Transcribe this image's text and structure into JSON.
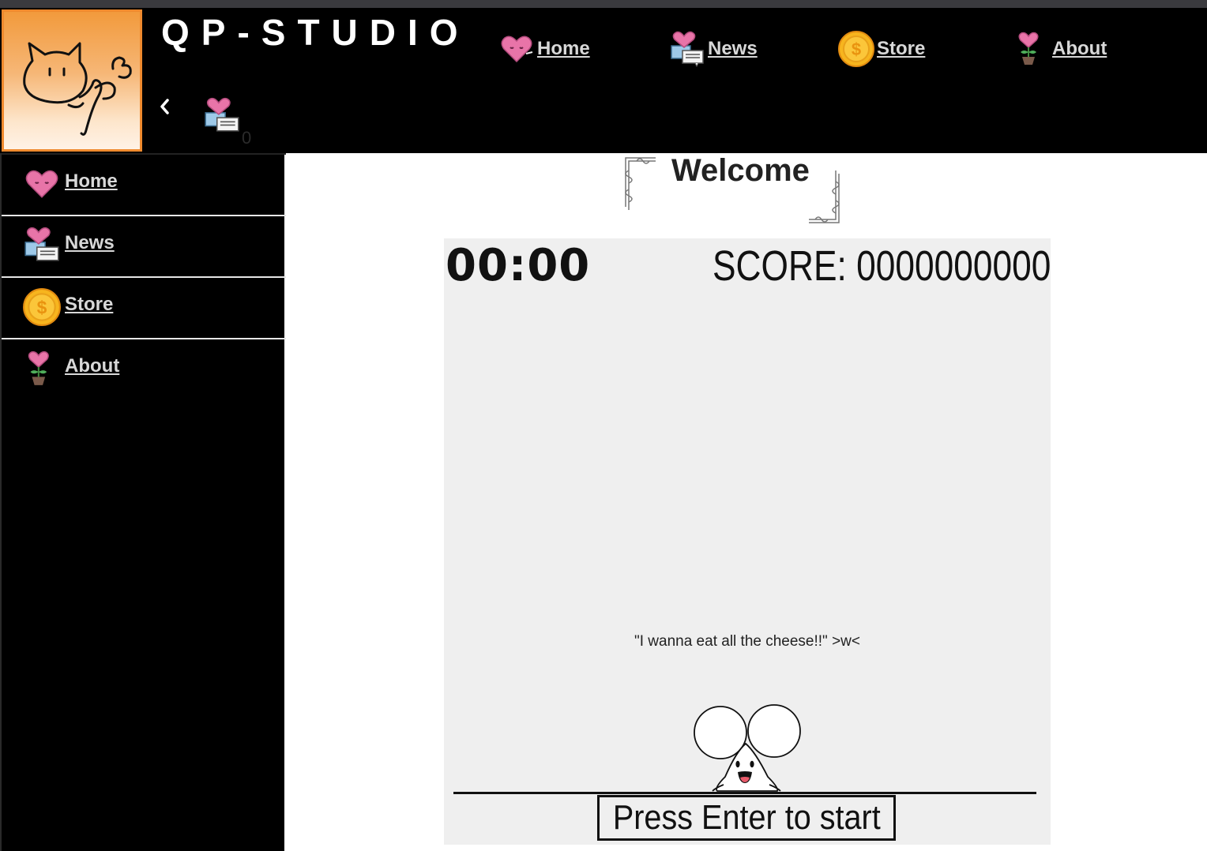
{
  "site": {
    "title": "QP-STUDIO"
  },
  "colors": {
    "accent_orange": "#f29a3c",
    "nav_text": "#d8d8d8",
    "bg_dark": "#000000",
    "game_bg": "#efefef"
  },
  "topnav": [
    {
      "label": " Home",
      "icon": "heart-icon"
    },
    {
      "label": " News",
      "icon": "heart-message-icon"
    },
    {
      "label": " Store",
      "icon": "gold-coin-icon"
    },
    {
      "label": " About",
      "icon": "heart-flower-icon"
    }
  ],
  "header": {
    "message_count": "0"
  },
  "sidebar": {
    "items": [
      {
        "label": " Home",
        "icon": "heart-icon"
      },
      {
        "label": " News",
        "icon": "heart-message-icon"
      },
      {
        "label": " Store",
        "icon": "gold-coin-icon"
      },
      {
        "label": " About",
        "icon": "heart-flower-icon"
      }
    ]
  },
  "main": {
    "heading": "Welcome"
  },
  "game": {
    "timer": "00:00",
    "score": "SCORE:  0000000000",
    "quote": "\"I wanna eat all the cheese!!\" >w<",
    "start_prompt": "Press Enter to start"
  }
}
